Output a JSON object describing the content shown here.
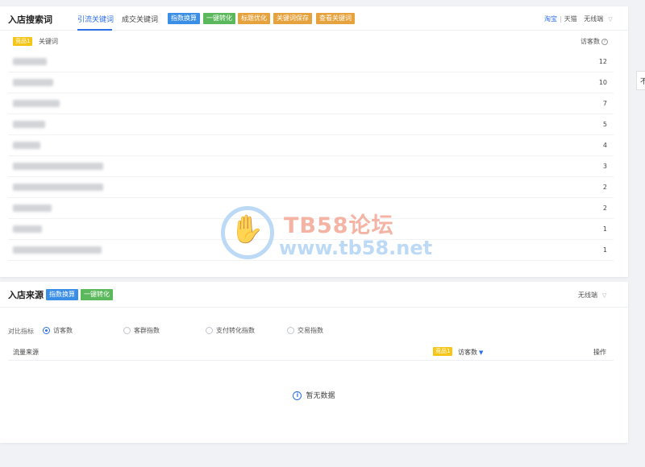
{
  "keyword_panel": {
    "title": "入店搜索词",
    "tabs": [
      {
        "label": "引流关键词",
        "active": true
      },
      {
        "label": "成交关键词",
        "active": false
      }
    ],
    "tools": [
      "指数换算",
      "一键转化",
      "标题优化",
      "关键词保存",
      "查看关键词"
    ],
    "platforms": [
      "淘宝",
      "天猫"
    ],
    "device": "无线端",
    "table": {
      "badge": "竞品1",
      "col_keyword": "关键词",
      "col_visits": "访客数",
      "rows": [
        {
          "keyword": "",
          "visits": "12"
        },
        {
          "keyword": "",
          "visits": "10"
        },
        {
          "keyword": "",
          "visits": "7"
        },
        {
          "keyword": "",
          "visits": "5"
        },
        {
          "keyword": "",
          "visits": "4"
        },
        {
          "keyword": "",
          "visits": "3"
        },
        {
          "keyword": "",
          "visits": "2"
        },
        {
          "keyword": "",
          "visits": "2"
        },
        {
          "keyword": "",
          "visits": "1"
        },
        {
          "keyword": "",
          "visits": "1"
        }
      ]
    }
  },
  "source_panel": {
    "title": "入店来源",
    "tools": [
      "指数换算",
      "一键转化"
    ],
    "device": "无线端",
    "compare_label": "对比指标",
    "metrics": [
      {
        "label": "访客数",
        "checked": true
      },
      {
        "label": "客群指数",
        "checked": false
      },
      {
        "label": "支付转化指数",
        "checked": false
      },
      {
        "label": "交易指数",
        "checked": false
      }
    ],
    "table": {
      "col_source": "流量来源",
      "badge": "竞品1",
      "col_visits": "访客数",
      "col_action": "操作"
    },
    "empty_text": "暂无数据"
  },
  "watermark": {
    "title": "TB58论坛",
    "url": "www.tb58.net"
  },
  "side_tab": "不"
}
